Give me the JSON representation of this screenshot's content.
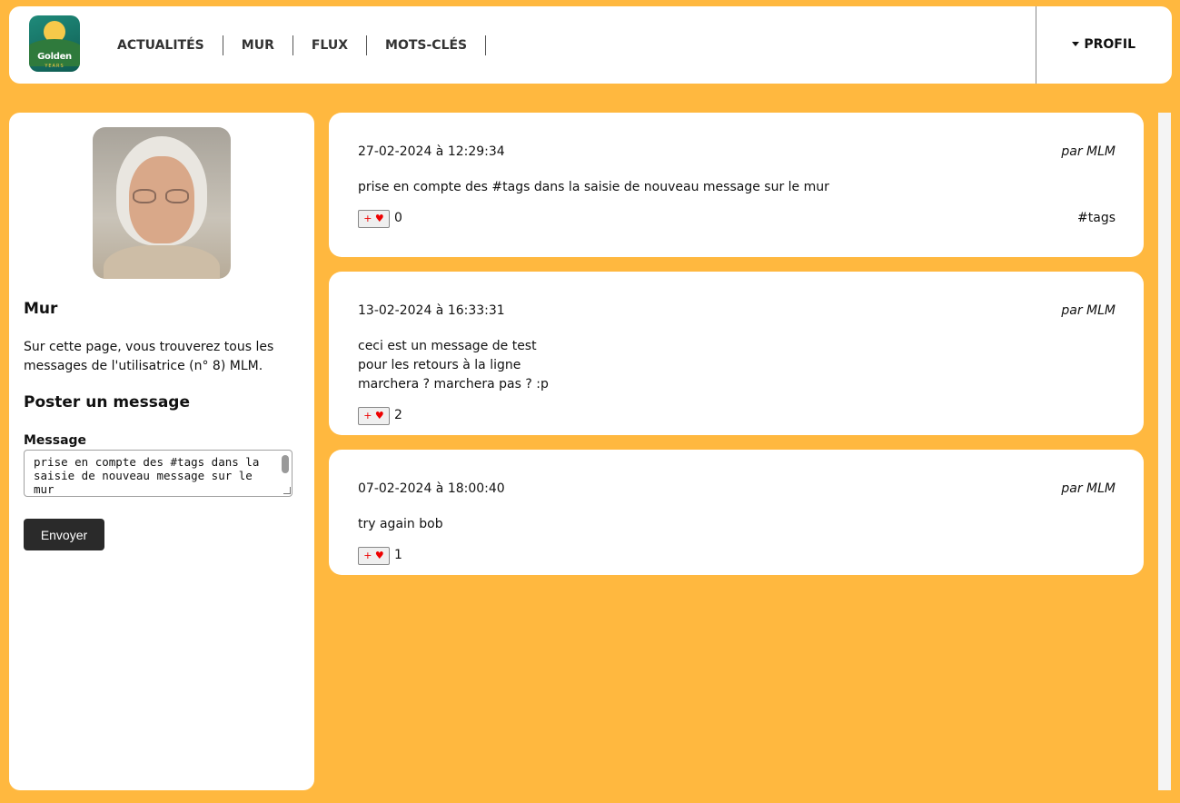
{
  "header": {
    "logo_text": "Golden",
    "logo_sub": "YEARS",
    "nav": [
      {
        "label": "ACTUALITÉS"
      },
      {
        "label": "MUR"
      },
      {
        "label": "FLUX"
      },
      {
        "label": "MOTS-CLÉS"
      }
    ],
    "profile_label": "PROFIL"
  },
  "sidebar": {
    "title": "Mur",
    "description": "Sur cette page, vous trouverez tous les messages de l'utilisatrice (n° 8) MLM.",
    "post_title": "Poster un message",
    "message_label": "Message",
    "message_value": "prise en compte des #tags dans la saisie de nouveau message sur le mur",
    "send_label": "Envoyer"
  },
  "posts": [
    {
      "date": "27-02-2024 à 12:29:34",
      "author": "par MLM",
      "content": "prise en compte des #tags dans la saisie de nouveau message sur le mur",
      "like_label": "+ ♥",
      "likes": "0",
      "tag": "#tags"
    },
    {
      "date": "13-02-2024 à 16:33:31",
      "author": "par MLM",
      "content": "ceci est un message de test\npour les retours à la ligne\nmarchera ? marchera pas ? :p",
      "like_label": "+ ♥",
      "likes": "2"
    },
    {
      "date": "07-02-2024 à 18:00:40",
      "author": "par MLM",
      "content": "try again bob",
      "like_label": "+ ♥",
      "likes": "1"
    }
  ],
  "colors": {
    "background": "#ffb83f",
    "button_dark": "#2a2a2a",
    "heart": "#e00000"
  }
}
